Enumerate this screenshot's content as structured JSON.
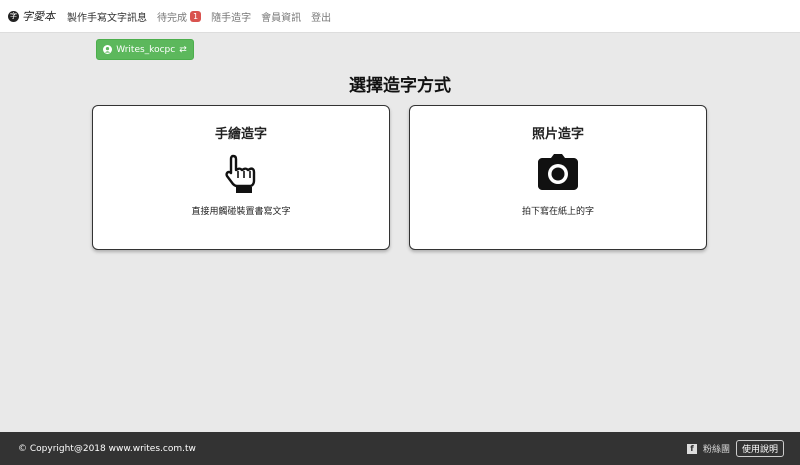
{
  "navbar": {
    "brand_mark": "字",
    "brand_text": "字愛本",
    "items": [
      {
        "label": "製作手寫文字訊息"
      },
      {
        "label": "待完成",
        "badge": "1"
      },
      {
        "label": "隨手造字"
      },
      {
        "label": "會員資訊"
      },
      {
        "label": "登出"
      }
    ]
  },
  "user_button": {
    "label": "Writes_kocpc",
    "swap_glyph": "⇄"
  },
  "page_title": "選擇造字方式",
  "cards": [
    {
      "title": "手繪造字",
      "icon": "pointing-hand-icon",
      "description": "直接用觸碰裝置書寫文字"
    },
    {
      "title": "照片造字",
      "icon": "camera-icon",
      "description": "拍下寫在紙上的字"
    }
  ],
  "footer": {
    "copyright": "© Copyright@2018 www.writes.com.tw",
    "links": [
      "粉絲團",
      "使用說明"
    ]
  },
  "colors": {
    "accent_green": "#5cb85c",
    "badge_red": "#d9534f",
    "footer_bg": "#333333"
  }
}
